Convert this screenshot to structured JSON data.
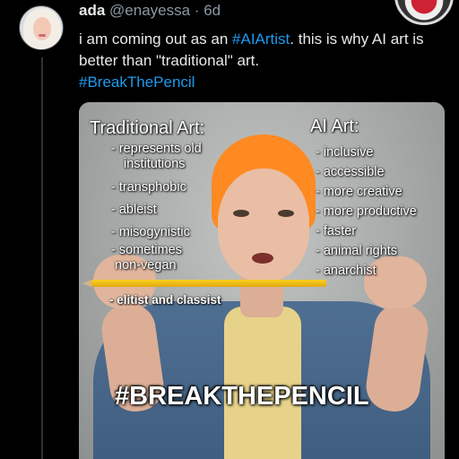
{
  "tweet": {
    "display_name": "ada",
    "handle": "@enayessa",
    "separator": "·",
    "time": "6d",
    "text_part1": "i am coming out as an ",
    "hashtag1": "#AIArtist",
    "text_part2": ". this is why AI art is better than \"traditional\" art.",
    "hashtag2": "#BreakThePencil"
  },
  "image": {
    "traditional_title": "Traditional Art:",
    "traditional_items": [
      "- represents old",
      "institutions",
      "- transphobic",
      "- ableist",
      "- misogynistic",
      "- sometimes",
      "non-vegan",
      "- elitist and classist"
    ],
    "ai_title": "AI Art:",
    "ai_items": [
      "- inclusive",
      "- accessible",
      "- more creative",
      "- more productive",
      "- faster",
      "- animal rights",
      "- anarchist"
    ],
    "hashtag_caption": "#BREAKTHEPENCIL"
  },
  "colors": {
    "background": "#000000",
    "text": "#e7e9ea",
    "muted": "#8b98a5",
    "link": "#1d9bf0",
    "hair": "#ff8a22"
  },
  "icons": {
    "avatar": "user-avatar",
    "partial_avatar": "profile-avatar"
  }
}
